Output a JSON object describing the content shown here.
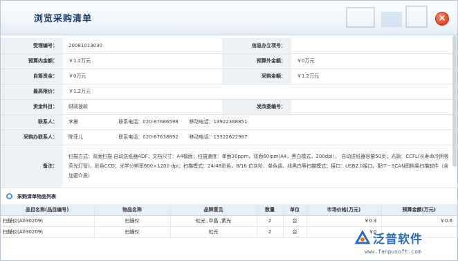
{
  "dialog": {
    "title": "浏览采购清单",
    "close_label": "×"
  },
  "info": {
    "order_no_label": "受理编号：",
    "order_no": "20081013030",
    "credit_no_label": "信息办立项号：",
    "credit_no": "",
    "budget_in_label": "预算内金额：",
    "budget_in": "￥1.2万元",
    "budget_out_label": "预算外金额：",
    "budget_out": "￥0万元",
    "self_fund_label": "自筹资金：",
    "self_fund": "￥0万元",
    "purchase_amt_label": "采购金额：",
    "purchase_amt": "￥1.2万元",
    "max_price_label": "最高限价：",
    "max_price": "￥1.2万元",
    "fund_item_label": "资金科目：",
    "fund_item": "财政拨款",
    "change_no_label": "发改委编号：",
    "change_no": "",
    "contact_label": "联系人：",
    "contact_name": "李晨",
    "contact_phone": "联系电话：020-87686598",
    "contact_mobile": "移动电话：13922368851",
    "handler_label": "采购办联系人：",
    "handler_name": "陈菲儿",
    "handler_phone": "联系电话：020-87638892",
    "handler_mobile": "移动电话：13322622987",
    "notes_label": "备注：",
    "notes": "扫描方式：双面扫描  自动送纸器ADF；文档尺寸：A4幅面；扫描速度：单面30ppm，双面60ipm(A4，黑白模式，200dpi）， 自动送纸器容量50页；光源：CCFL(长寿命冷阴极荧光灯管)，彩色CCD；光学分辨率600×1200 dpi；扫描模式：24/48彩色，8/16 位灰阶、单色调、线黑白等扫描模式；接口：USB2.0接口。配IT－SCAN图档易扫描软件（含加密介质）"
  },
  "items_section": {
    "title": "采购清单物品列表"
  },
  "items_table": {
    "headers": [
      "品目名称(品目编号)",
      "物品名称",
      "品牌意见",
      "数量",
      "单位",
      "市场价格(万元)",
      "预算金额(万元)"
    ],
    "rows": [
      [
        "扫描仪(A030209)",
        "扫描仪",
        "虹光 ,中晶 ,紫光",
        "2",
        "台",
        "￥0.3",
        "￥0.6"
      ],
      [
        "扫描仪(A030209)",
        "扫描仪",
        "虹光",
        "2",
        "台",
        "￥0",
        ""
      ]
    ]
  },
  "watermark": {
    "name": "泛普软件",
    "url": "www.fanpusoft.com"
  }
}
